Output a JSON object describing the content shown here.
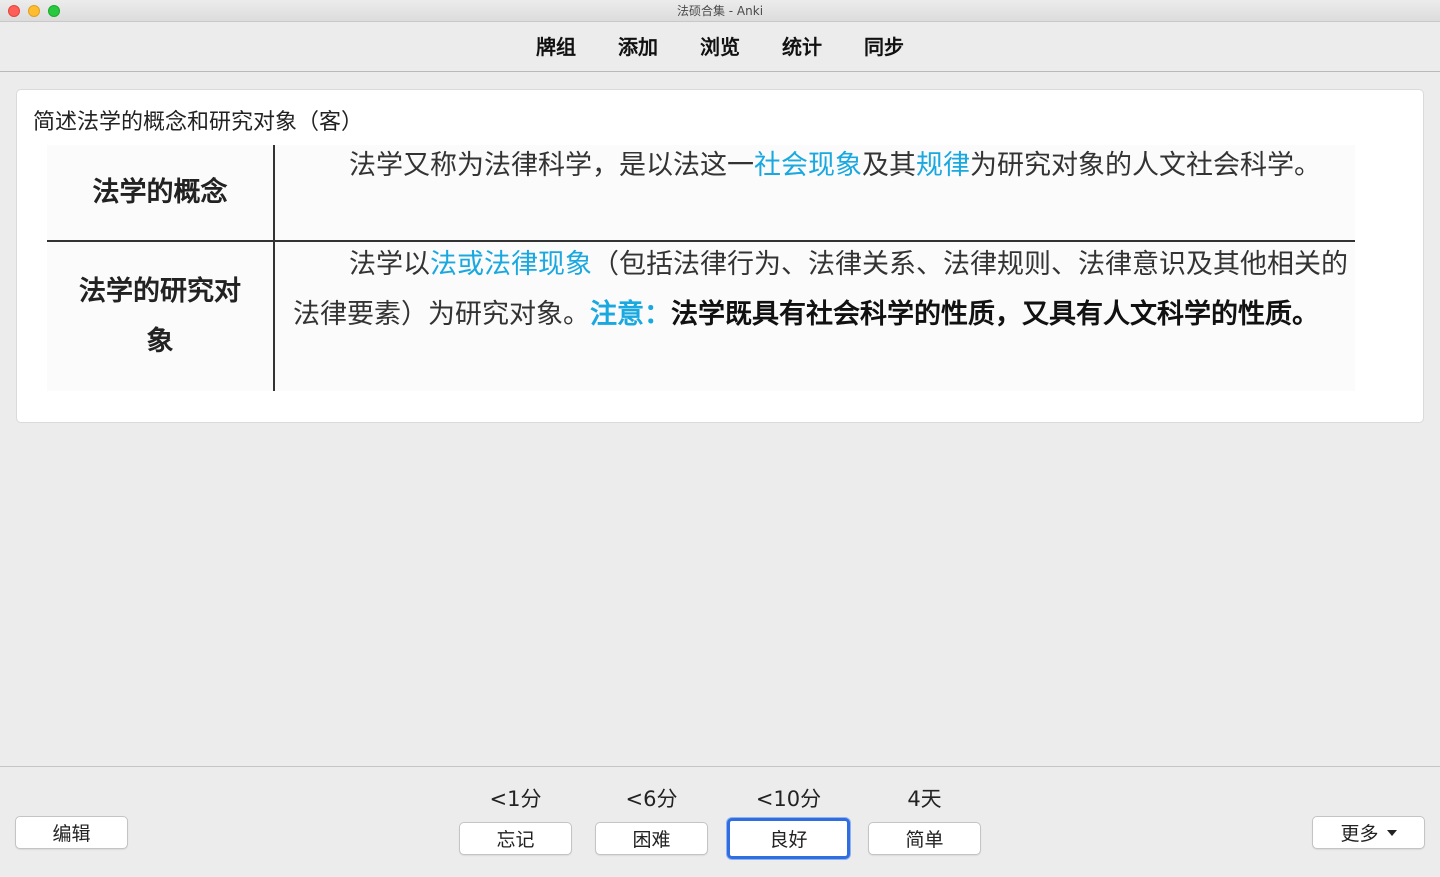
{
  "window": {
    "title": "法硕合集 - Anki"
  },
  "toolbar": {
    "items": [
      "牌组",
      "添加",
      "浏览",
      "统计",
      "同步"
    ]
  },
  "card": {
    "question": "简述法学的概念和研究对象（客）",
    "rows": [
      {
        "term": "法学的概念",
        "definition": {
          "p1": "法学又称为法律科学，是以法这一",
          "h1": "社会现象",
          "p2": "及其",
          "h2": "规律",
          "p3": "为研究对象的人文社会科学。"
        }
      },
      {
        "term": "法学的研究对象",
        "definition": {
          "p1": "法学以",
          "h1": "法或法律现象",
          "p2": "（包括法律行为、法律关系、法律规则、法律意识及其他相关的法律要素）为研究对象。",
          "note": "注意：",
          "strong": "法学既具有社会科学的性质，又具有人文科学的性质。"
        }
      }
    ],
    "highlight_color": "#1aa8e0"
  },
  "bottom": {
    "edit_label": "编辑",
    "more_label": "更多",
    "answers": [
      {
        "interval": "<1分",
        "label": "忘记"
      },
      {
        "interval": "<6分",
        "label": "困难"
      },
      {
        "interval": "<10分",
        "label": "良好"
      },
      {
        "interval": "4天",
        "label": "简单"
      }
    ],
    "focused_color": "#2f6de0"
  }
}
